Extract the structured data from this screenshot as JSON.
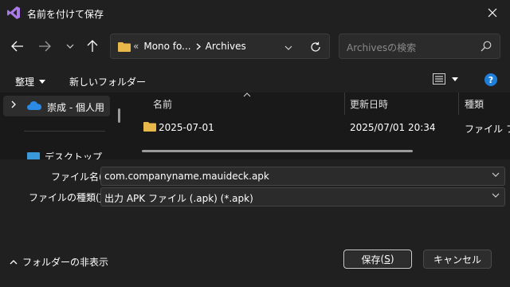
{
  "window": {
    "title": "名前を付けて保存"
  },
  "address": {
    "crumbs": [
      "«",
      "Mono fo...",
      "Archives"
    ]
  },
  "search": {
    "placeholder": "Archivesの検索"
  },
  "commands": {
    "organize": "整理",
    "new_folder": "新しいフォルダー"
  },
  "nav": {
    "selected": "崇成 - 個人用",
    "item2": "デスクトップ"
  },
  "columns": {
    "name": "名前",
    "date": "更新日時",
    "type": "種類"
  },
  "files": [
    {
      "name": "2025-07-01",
      "date": "2025/07/01 20:34",
      "type": "ファイル フォル"
    }
  ],
  "form": {
    "filename_label": "ファイル名",
    "filename_key": "N",
    "filename_value": "com.companyname.mauideck.apk",
    "filetype_label": "ファイルの種類",
    "filetype_key": "T",
    "filetype_value": "出力 APK ファイル (.apk) (*.apk)"
  },
  "footer": {
    "hide_folders": "フォルダーの非表示",
    "save_label": "保存",
    "save_key": "S",
    "cancel_label": "キャンセル"
  },
  "colors": {
    "accent": "#1f7ed8",
    "folder": "#e8b84a",
    "background": "#202020",
    "pane": "#191919"
  }
}
